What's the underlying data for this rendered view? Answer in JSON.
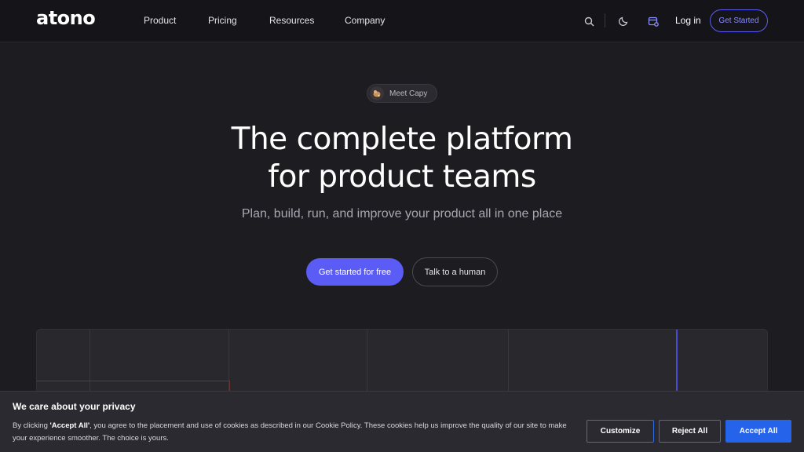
{
  "header": {
    "logo": "atono",
    "nav": [
      {
        "label": "Product"
      },
      {
        "label": "Pricing"
      },
      {
        "label": "Resources"
      },
      {
        "label": "Company"
      }
    ],
    "icons": [
      "search-icon",
      "moon-icon",
      "calendar-icon"
    ],
    "login_label": "Log in",
    "cta_label": "Get Started"
  },
  "hero": {
    "pill_label": "Meet Capy",
    "title_line1": "The complete platform",
    "title_line2": "for product teams",
    "subtitle": "Plan, build, run, and improve your product all in one place",
    "primary_cta": "Get started for free",
    "secondary_cta": "Talk to a human"
  },
  "cookie": {
    "title": "We care about your privacy",
    "text_prefix": "By clicking ",
    "text_bold": "'Accept All'",
    "text_suffix": ", you agree to the placement and use of cookies as described in our Cookie Policy. These cookies help us improve the quality of our site to make your experience smoother. The choice is yours.",
    "customize_label": "Customize",
    "reject_label": "Reject All",
    "accept_label": "Accept All"
  },
  "colors": {
    "accent": "#5b5bf6",
    "cookie_button": "#2563eb",
    "background": "#1d1c21"
  }
}
